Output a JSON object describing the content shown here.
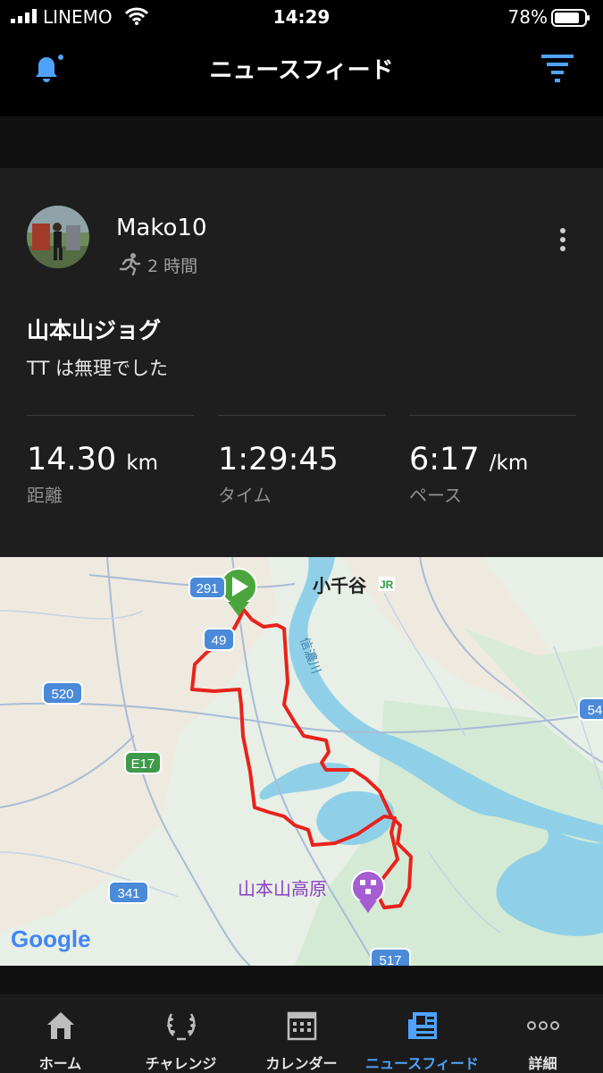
{
  "status_bar": {
    "carrier": "LINEMO",
    "time": "14:29",
    "battery": "78%"
  },
  "header": {
    "title": "ニュースフィード",
    "bell_icon": "bell-icon",
    "filter_icon": "filter-icon"
  },
  "post": {
    "username": "Mako10",
    "activity_icon": "running-icon",
    "time_ago": "2 時間",
    "title": "山本山ジョグ",
    "description": "TT は無理でした",
    "stats": [
      {
        "value": "14.30",
        "unit": "km",
        "label": "距離"
      },
      {
        "value": "1:29:45",
        "unit": "",
        "label": "タイム"
      },
      {
        "value": "6:17",
        "unit": "/km",
        "label": "ペース"
      }
    ]
  },
  "map": {
    "place_station": "小千谷",
    "place_park": "山本山高原",
    "river_label": "信濃川",
    "road_shields": [
      "291",
      "49",
      "520",
      "E17",
      "341",
      "517",
      "54"
    ],
    "attribution": "Google",
    "route_color": "#e8221c"
  },
  "tabbar": {
    "tabs": [
      {
        "label": "ホーム",
        "icon": "home-icon",
        "active": false
      },
      {
        "label": "チャレンジ",
        "icon": "laurel-icon",
        "active": false
      },
      {
        "label": "カレンダー",
        "icon": "calendar-icon",
        "active": false
      },
      {
        "label": "ニュースフィード",
        "icon": "newsfeed-icon",
        "active": true
      },
      {
        "label": "詳細",
        "icon": "more-dots-icon",
        "active": false
      }
    ]
  },
  "colors": {
    "accent": "#4fa3ff",
    "background": "#000000",
    "card": "#1e1e1e"
  }
}
